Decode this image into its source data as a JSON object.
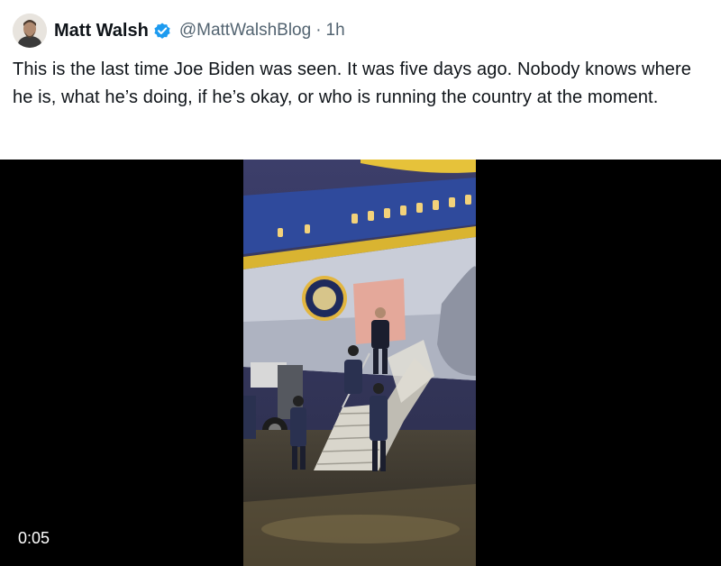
{
  "author": {
    "name": "Matt Walsh",
    "handle": "@MattWalshBlog",
    "time": "1h",
    "separator": "·",
    "verified_color": "#1d9bf0"
  },
  "tweet": {
    "text": "This is the last time Joe Biden was seen. It was five days ago. Nobody knows where he is, what he’s doing, if he’s okay, or who is running the country at the moment."
  },
  "media": {
    "type": "video",
    "duration": "0:05"
  },
  "icons": {
    "verified": "verified-badge-icon"
  }
}
